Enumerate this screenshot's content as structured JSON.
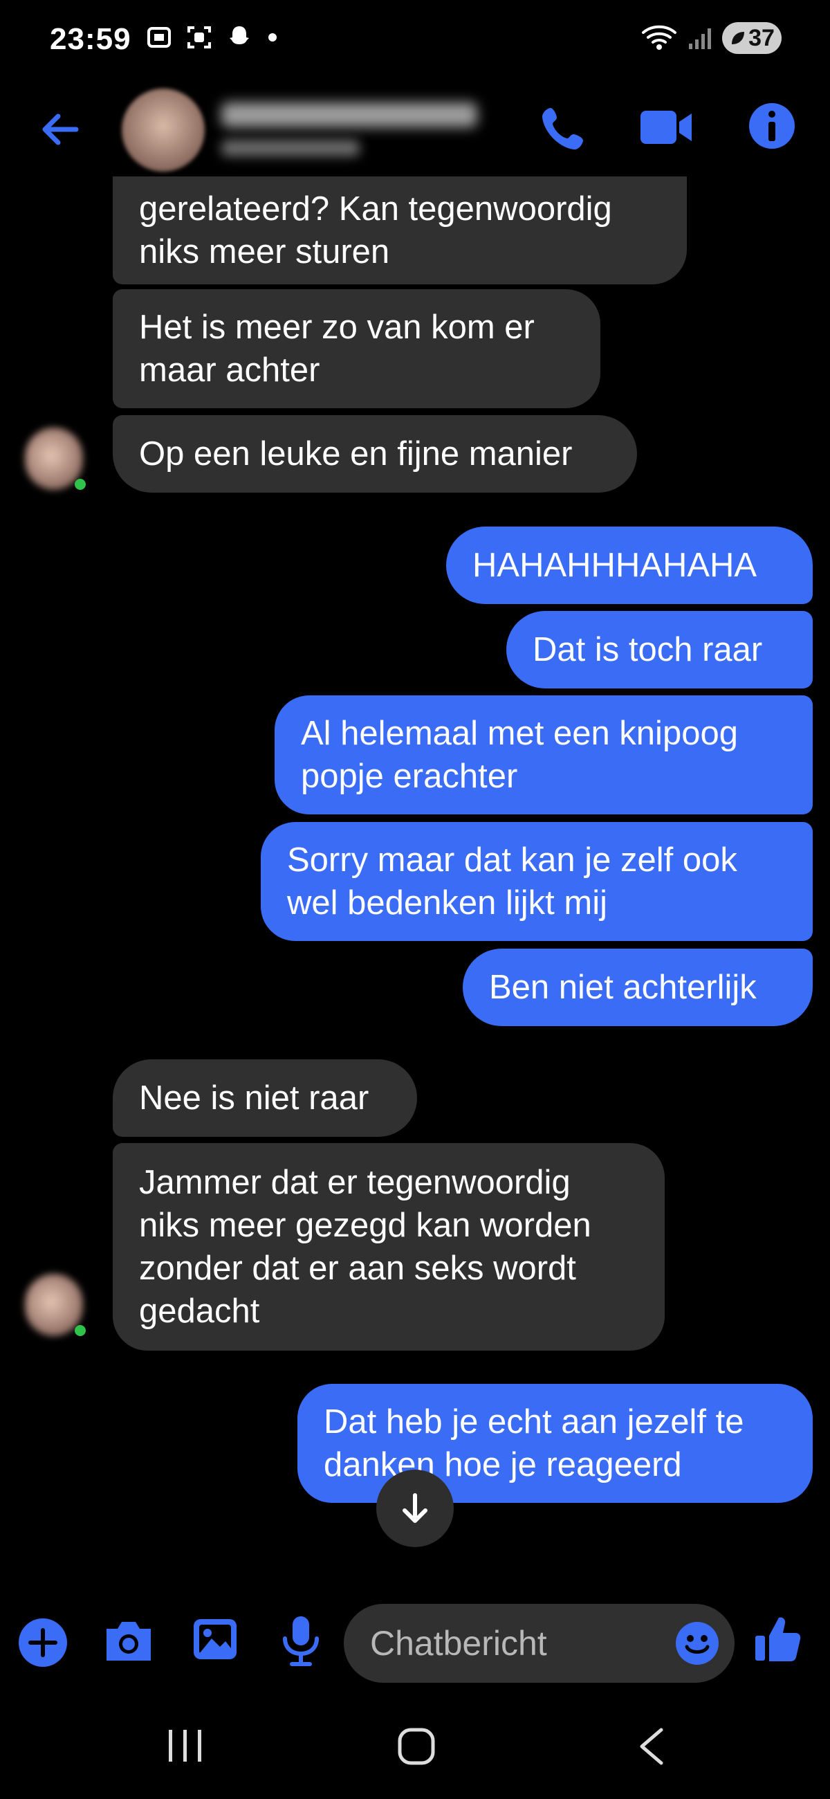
{
  "status_bar": {
    "time": "23:59",
    "battery": "37"
  },
  "chat_input": {
    "placeholder": "Chatbericht"
  },
  "messages": [
    {
      "side": "in",
      "text": "gerelateerd? Kan tegenwoordig\nniks meer sturen"
    },
    {
      "side": "in",
      "text": "Het is meer zo van kom er\nmaar achter"
    },
    {
      "side": "in",
      "text": "Op een leuke en fijne manier"
    },
    {
      "side": "out",
      "text": "HAHAHHHAHAHA"
    },
    {
      "side": "out",
      "text": "Dat is toch raar"
    },
    {
      "side": "out",
      "text": "Al helemaal met een knipoog\npopje erachter"
    },
    {
      "side": "out",
      "text": "Sorry maar dat kan je zelf ook\nwel bedenken lijkt mij"
    },
    {
      "side": "out",
      "text": "Ben niet achterlijk"
    },
    {
      "side": "in",
      "text": "Nee is niet raar"
    },
    {
      "side": "in",
      "text": "Jammer dat er tegenwoordig\nniks meer gezegd kan worden\nzonder dat er aan seks wordt\ngedacht"
    },
    {
      "side": "out",
      "text": "Dat heb je echt aan jezelf te\ndanken hoe je reageerd"
    }
  ],
  "colors": {
    "accent": "#3a6cf6",
    "incoming_bubble": "#303030",
    "background": "#000000",
    "online": "#2fc34b"
  },
  "icons": [
    "back-arrow-icon",
    "phone-icon",
    "video-camera-icon",
    "info-icon",
    "plus-icon",
    "camera-icon",
    "image-icon",
    "microphone-icon",
    "emoji-icon",
    "thumbs-up-icon",
    "arrow-down-icon"
  ]
}
